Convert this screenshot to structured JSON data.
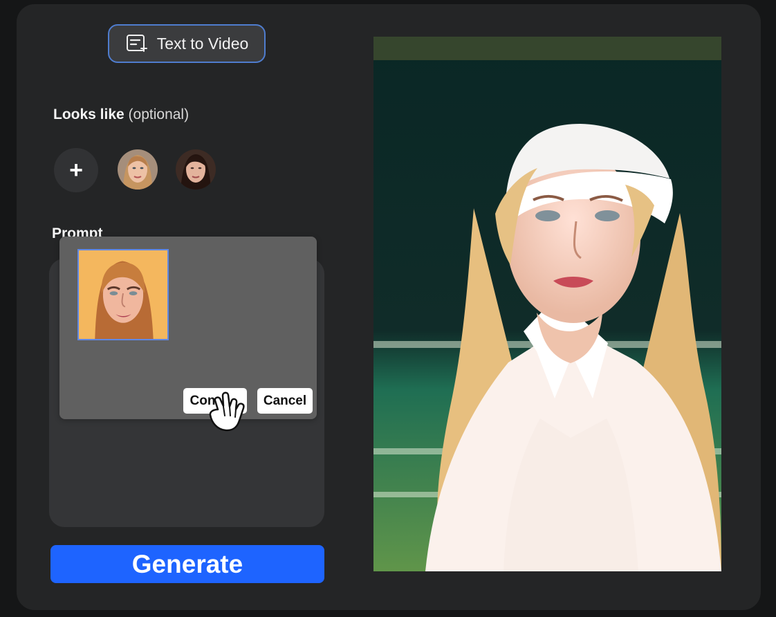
{
  "mode": {
    "label": "Text to Video",
    "icon": "text-to-video-icon"
  },
  "looks": {
    "title": "Looks like",
    "optional": "(optional)",
    "add_label": "+",
    "faces": [
      {
        "name": "blonde-face-avatar"
      },
      {
        "name": "brunette-face-avatar"
      }
    ]
  },
  "prompt": {
    "label": "Prompt"
  },
  "upload_popup": {
    "confirm_label": "Con",
    "cancel_label": "Cancel",
    "preview_name": "uploaded-face-preview",
    "preview_background": "#f4b75e",
    "selected_border": "#5f88e6"
  },
  "generate": {
    "label": "Generate",
    "color": "#1e64ff"
  },
  "preview": {
    "name": "generated-video-preview",
    "background": "#0b1b1a"
  }
}
